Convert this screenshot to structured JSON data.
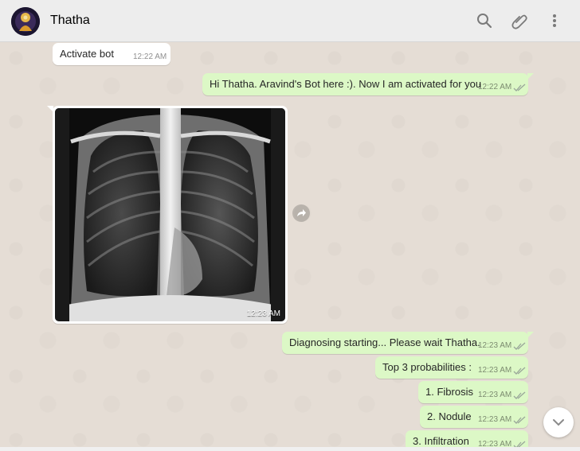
{
  "header": {
    "contact_name": "Thatha",
    "icons": [
      "search-icon",
      "attach-icon",
      "menu-icon"
    ]
  },
  "messages": [
    {
      "direction": "incoming",
      "text": "Activate bot",
      "time": "12:22 AM"
    },
    {
      "direction": "outgoing",
      "text": "Hi Thatha. Aravind's Bot here :). Now I am activated for you",
      "time": "12:22 AM",
      "status": "read"
    },
    {
      "direction": "incoming",
      "type": "image",
      "image": "chest-xray",
      "time": "12:23 AM"
    },
    {
      "direction": "outgoing",
      "text": "Diagnosing starting... Please wait Thatha.",
      "time": "12:23 AM",
      "status": "read"
    },
    {
      "direction": "outgoing",
      "text": "Top 3 probabilities :",
      "time": "12:23 AM",
      "status": "read"
    },
    {
      "direction": "outgoing",
      "text": "1. Fibrosis",
      "time": "12:23 AM",
      "status": "read"
    },
    {
      "direction": "outgoing",
      "text": "2. Nodule",
      "time": "12:23 AM",
      "status": "read"
    },
    {
      "direction": "outgoing",
      "text": "3. Infiltration",
      "time": "12:23 AM",
      "status": "read"
    }
  ],
  "colors": {
    "incoming_bubble": "#ffffff",
    "outgoing_bubble": "#dcf8c6",
    "chat_background": "#e5ddd5",
    "header_background": "#ededed"
  }
}
